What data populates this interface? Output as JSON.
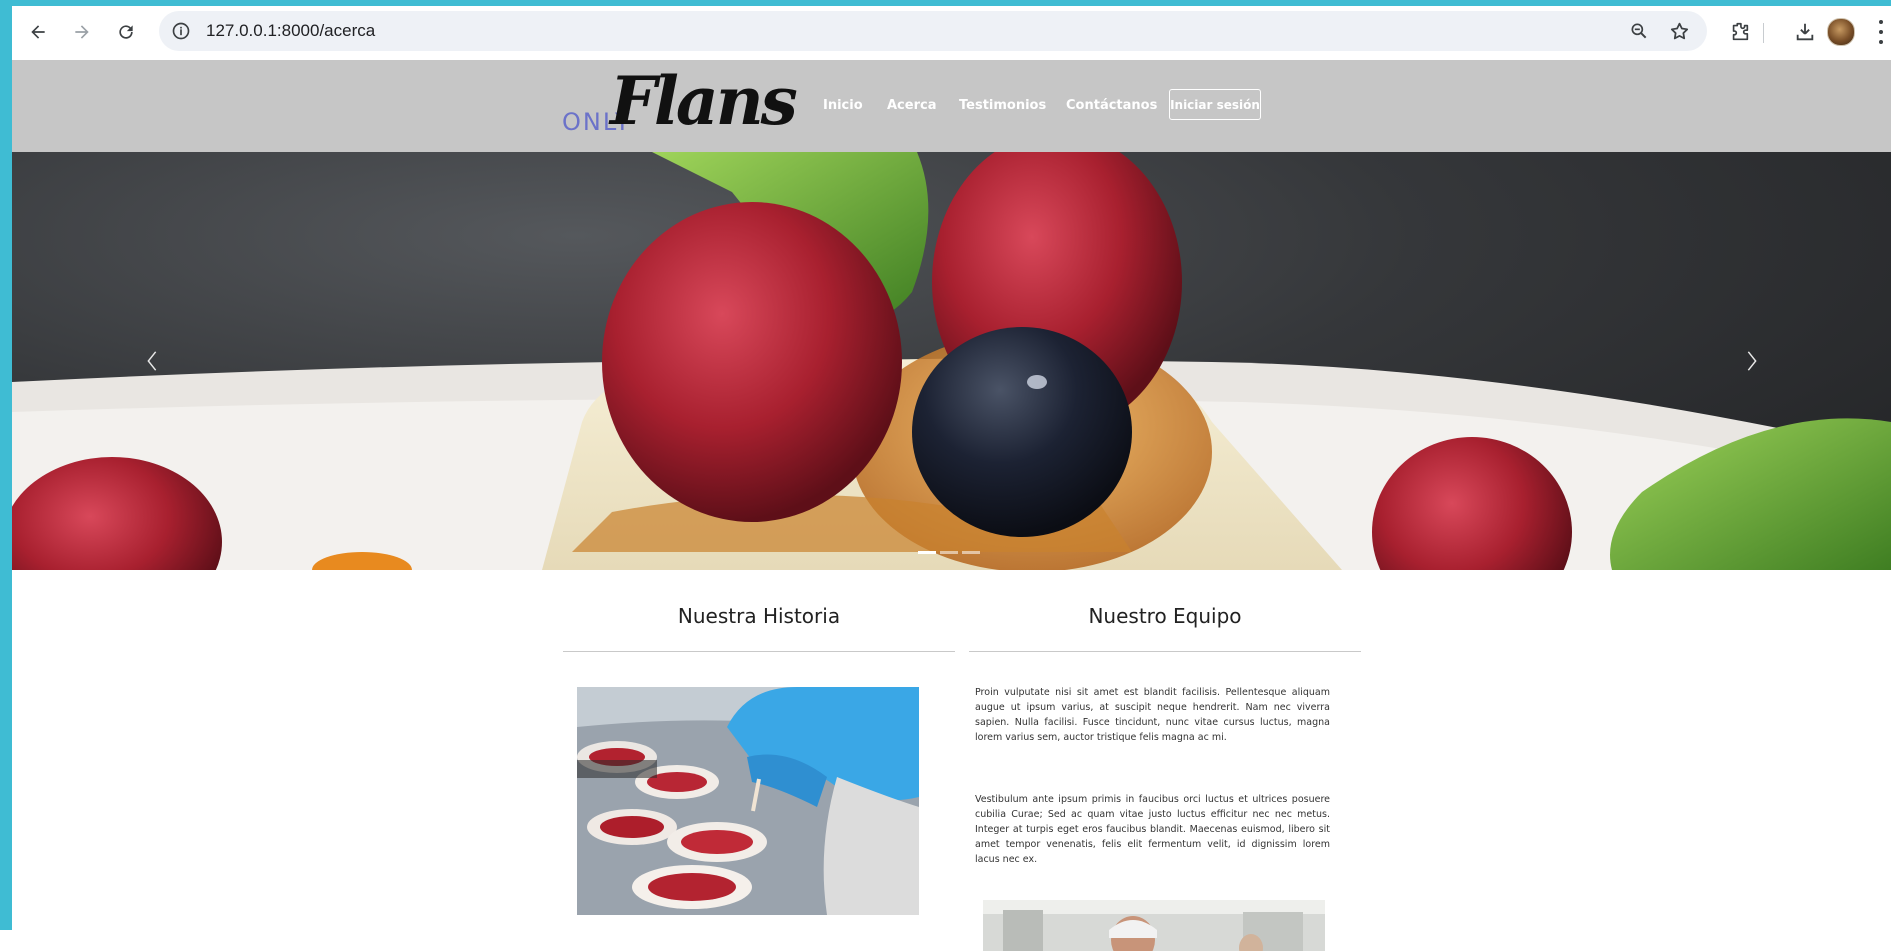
{
  "browser": {
    "url": "127.0.0.1:8000/acerca"
  },
  "header": {
    "logo_only": "ONLY",
    "logo_brand": "Flans",
    "nav": [
      {
        "label": "Inicio"
      },
      {
        "label": "Acerca"
      },
      {
        "label": "Testimonios"
      },
      {
        "label": "Contáctanos"
      }
    ],
    "login_label": "Iniciar sesión"
  },
  "carousel": {
    "slide_count": 3,
    "active_slide": 1
  },
  "sections": {
    "history_title": "Nuestra Historia",
    "team_title": "Nuestro Equipo",
    "paragraph_1": "Proin vulputate nisi sit amet est blandit facilisis. Pellentesque aliquam augue ut ipsum varius, at suscipit neque hendrerit. Nam nec viverra sapien. Nulla facilisi. Fusce tincidunt, nunc vitae cursus luctus, magna lorem varius sem, auctor tristique felis magna ac mi.",
    "paragraph_2": "Vestibulum ante ipsum primis in faucibus orci luctus et ultrices posuere cubilia Curae; Sed ac quam vitae justo luctus efficitur nec nec metus. Integer at turpis eget eros faucibus blandit. Maecenas euismod, libero sit amet tempor venenatis, felis elit fermentum velit, id dignissim lorem lacus nec ex."
  },
  "icons": {
    "back": "back-arrow-icon",
    "forward": "forward-arrow-icon",
    "reload": "reload-icon",
    "site_info": "site-info-icon",
    "zoom": "zoom-icon",
    "bookmark": "star-icon",
    "extensions": "puzzle-icon",
    "downloads": "download-icon",
    "menu": "kebab-menu-icon"
  },
  "colors": {
    "accent_strip": "#3fbcd3",
    "header_bg": "#c6c6c6",
    "logo_only": "#6b72c9"
  }
}
